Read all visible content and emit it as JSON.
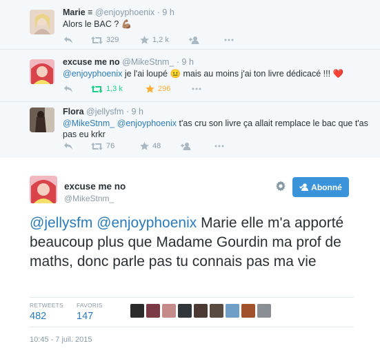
{
  "replies": [
    {
      "name": "Marie ≡",
      "handle": "@enjoyphoenix",
      "sep": "·",
      "time": "9 h",
      "text": "Alors le BAC ? 💪🏽",
      "mentions": [],
      "retweets": "329",
      "favorites": "1,2 k",
      "retweeted": false,
      "favorited": false,
      "avatar_color": "#e8d6c8"
    },
    {
      "name": "excuse me no",
      "handle": "@MikeStnm_",
      "sep": "·",
      "time": "9 h",
      "mentions": [
        "@enjoyphoenix"
      ],
      "text": " je l'ai loupé 😐 mais au moins j'ai ton livre dédicacé !!! ❤️",
      "retweets": "1,3 k",
      "favorites": "296",
      "retweeted": true,
      "favorited": true,
      "avatar_color": "#d9434a"
    },
    {
      "name": "Flora",
      "handle": "@jellysfm",
      "sep": "·",
      "time": "9 h",
      "mentions": [
        "@MikeStnm_",
        "@enjoyphoenix"
      ],
      "text": " t'as cru son livre ça allait remplace le bac que t'as pas eu krkr",
      "retweets": "76",
      "favorites": "48",
      "retweeted": false,
      "favorited": false,
      "avatar_color": "#3a2c24"
    }
  ],
  "main_tweet": {
    "name": "excuse me no",
    "handle": "@MikeStnm_",
    "follow_label": "Abonné",
    "mentions": [
      "@jellysfm",
      "@enjoyphoenix"
    ],
    "text": " Marie elle m'a apporté beaucoup plus que Madame Gourdin ma prof de maths, donc parle pas tu connais pas ma vie",
    "retweets_label": "RETWEETS",
    "retweets": "482",
    "favorites_label": "FAVORIS",
    "favorites": "147",
    "timestamp": "10:45 - 7 juil. 2015",
    "favoriter_colors": [
      "#2b2b2b",
      "#7a3b46",
      "#c58b8b",
      "#30363a",
      "#4a3a33",
      "#5a4b42",
      "#6f9ec7",
      "#a0522d",
      "#8a8f95"
    ]
  },
  "colors": {
    "link": "#2b7bb9",
    "retweet_active": "#19cf86",
    "favorite_active": "#ffac33",
    "follow_button": "#3b94d9",
    "muted": "#8899a6"
  },
  "icons": [
    "reply-icon",
    "retweet-icon",
    "favorite-icon",
    "follow-icon",
    "more-icon",
    "gear-icon"
  ]
}
